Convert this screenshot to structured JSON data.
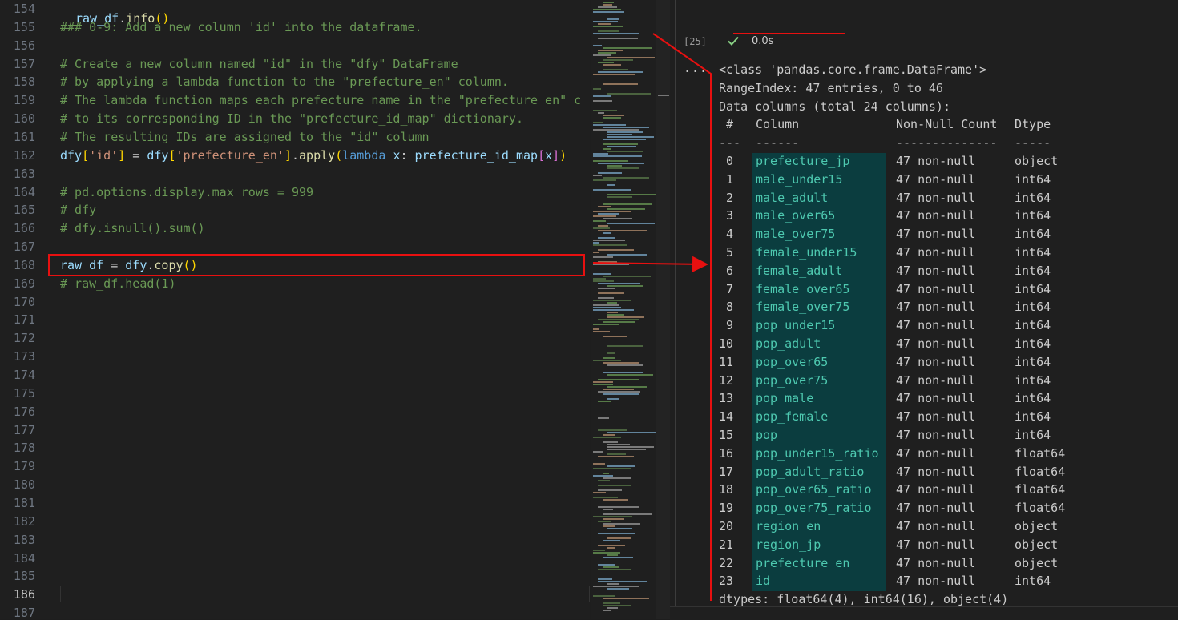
{
  "editor": {
    "lines": [
      {
        "num": "154",
        "html": ""
      },
      {
        "num": "155",
        "html": "<span class='cm'>### 0-9: Add a new column 'id' into the dataframe.</span>"
      },
      {
        "num": "156",
        "html": ""
      },
      {
        "num": "157",
        "html": "<span class='cm'># Create a new column named \"id\" in the \"dfy\" DataFrame</span>"
      },
      {
        "num": "158",
        "html": "<span class='cm'># by applying a lambda function to the \"prefecture_en\" column.</span>"
      },
      {
        "num": "159",
        "html": "<span class='cm'># The lambda function maps each prefecture name in the \"prefecture_en\" c</span>"
      },
      {
        "num": "160",
        "html": "<span class='cm'># to its corresponding ID in the \"prefecture_id_map\" dictionary.</span>"
      },
      {
        "num": "161",
        "html": "<span class='cm'># The resulting IDs are assigned to the \"id\" column</span>"
      },
      {
        "num": "162",
        "html": "<span class='var'>dfy</span><span class='p1'>[</span><span class='str'>'id'</span><span class='p1'>]</span><span class='op'> = </span><span class='var'>dfy</span><span class='p1'>[</span><span class='str'>'prefecture_en'</span><span class='p1'>]</span><span class='op'>.</span><span class='fn'>apply</span><span class='p1'>(</span><span class='kw'>lambda</span><span class='op'> </span><span class='var'>x</span><span class='op'>: </span><span class='var'>prefecture_id_map</span><span class='p2'>[</span><span class='var'>x</span><span class='p2'>]</span><span class='p1'>)</span>"
      },
      {
        "num": "163",
        "html": ""
      },
      {
        "num": "164",
        "html": "<span class='cm'># pd.options.display.max_rows = 999</span>"
      },
      {
        "num": "165",
        "html": "<span class='cm'># dfy</span>"
      },
      {
        "num": "166",
        "html": "<span class='cm'># dfy.isnull().sum()</span>"
      },
      {
        "num": "167",
        "html": ""
      },
      {
        "num": "168",
        "html": "<span class='var'>raw_df</span><span class='op'> = </span><span class='var'>dfy</span><span class='op'>.</span><span class='fn'>copy</span><span class='p1'>()</span>"
      },
      {
        "num": "169",
        "html": "<span class='cm'># raw_df.head(1)</span>"
      },
      {
        "num": "170",
        "html": ""
      },
      {
        "num": "171",
        "html": ""
      },
      {
        "num": "172",
        "html": ""
      },
      {
        "num": "173",
        "html": ""
      },
      {
        "num": "174",
        "html": ""
      },
      {
        "num": "175",
        "html": ""
      },
      {
        "num": "176",
        "html": ""
      },
      {
        "num": "177",
        "html": ""
      },
      {
        "num": "178",
        "html": ""
      },
      {
        "num": "179",
        "html": ""
      },
      {
        "num": "180",
        "html": ""
      },
      {
        "num": "181",
        "html": ""
      },
      {
        "num": "182",
        "html": ""
      },
      {
        "num": "183",
        "html": ""
      },
      {
        "num": "184",
        "html": ""
      },
      {
        "num": "185",
        "html": ""
      },
      {
        "num": "186",
        "html": "",
        "active": true
      },
      {
        "num": "187",
        "html": ""
      }
    ]
  },
  "notebook": {
    "cell_code_html": "<span class='var'>raw_df</span><span class='op'>.</span><span class='fn'>info</span><span class='p1'>()</span>",
    "exec_count": "[25]",
    "exec_time": "0.0s",
    "more_glyph": "···",
    "output": {
      "header_lines": [
        "<class 'pandas.core.frame.DataFrame'>",
        "RangeIndex: 47 entries, 0 to 46",
        "Data columns (total 24 columns):"
      ],
      "table_header": {
        "idx": " #",
        "column": "Column",
        "nonnull": "Non-Null Count",
        "dtype": "Dtype"
      },
      "table_sep": {
        "idx": "---",
        "column": "------",
        "nonnull": "--------------",
        "dtype": "-----"
      },
      "rows": [
        {
          "idx": "0",
          "column": "prefecture_jp",
          "nonnull": "47 non-null",
          "dtype": "object"
        },
        {
          "idx": "1",
          "column": "male_under15",
          "nonnull": "47 non-null",
          "dtype": "int64"
        },
        {
          "idx": "2",
          "column": "male_adult",
          "nonnull": "47 non-null",
          "dtype": "int64"
        },
        {
          "idx": "3",
          "column": "male_over65",
          "nonnull": "47 non-null",
          "dtype": "int64"
        },
        {
          "idx": "4",
          "column": "male_over75",
          "nonnull": "47 non-null",
          "dtype": "int64"
        },
        {
          "idx": "5",
          "column": "female_under15",
          "nonnull": "47 non-null",
          "dtype": "int64"
        },
        {
          "idx": "6",
          "column": "female_adult",
          "nonnull": "47 non-null",
          "dtype": "int64"
        },
        {
          "idx": "7",
          "column": "female_over65",
          "nonnull": "47 non-null",
          "dtype": "int64"
        },
        {
          "idx": "8",
          "column": "female_over75",
          "nonnull": "47 non-null",
          "dtype": "int64"
        },
        {
          "idx": "9",
          "column": "pop_under15",
          "nonnull": "47 non-null",
          "dtype": "int64"
        },
        {
          "idx": "10",
          "column": "pop_adult",
          "nonnull": "47 non-null",
          "dtype": "int64"
        },
        {
          "idx": "11",
          "column": "pop_over65",
          "nonnull": "47 non-null",
          "dtype": "int64"
        },
        {
          "idx": "12",
          "column": "pop_over75",
          "nonnull": "47 non-null",
          "dtype": "int64"
        },
        {
          "idx": "13",
          "column": "pop_male",
          "nonnull": "47 non-null",
          "dtype": "int64"
        },
        {
          "idx": "14",
          "column": "pop_female",
          "nonnull": "47 non-null",
          "dtype": "int64"
        },
        {
          "idx": "15",
          "column": "pop",
          "nonnull": "47 non-null",
          "dtype": "int64"
        },
        {
          "idx": "16",
          "column": "pop_under15_ratio",
          "nonnull": "47 non-null",
          "dtype": "float64"
        },
        {
          "idx": "17",
          "column": "pop_adult_ratio",
          "nonnull": "47 non-null",
          "dtype": "float64"
        },
        {
          "idx": "18",
          "column": "pop_over65_ratio",
          "nonnull": "47 non-null",
          "dtype": "float64"
        },
        {
          "idx": "19",
          "column": "pop_over75_ratio",
          "nonnull": "47 non-null",
          "dtype": "float64"
        },
        {
          "idx": "20",
          "column": "region_en",
          "nonnull": "47 non-null",
          "dtype": "object"
        },
        {
          "idx": "21",
          "column": "region_jp",
          "nonnull": "47 non-null",
          "dtype": "object"
        },
        {
          "idx": "22",
          "column": "prefecture_en",
          "nonnull": "47 non-null",
          "dtype": "object"
        },
        {
          "idx": "23",
          "column": "id",
          "nonnull": "47 non-null",
          "dtype": "int64"
        }
      ],
      "footer": "dtypes: float64(4), int64(16), object(4)"
    }
  },
  "colors": {
    "annotation": "#e81010",
    "comment": "#6a9955",
    "string": "#ce9178",
    "keyword": "#569cd6",
    "variable": "#9cdcfe",
    "function": "#dcdcaa",
    "column_highlight": "#0b3d3f",
    "column_text": "#4ec9b0"
  },
  "icons": {
    "check": "check-icon",
    "more": "more-icon"
  }
}
